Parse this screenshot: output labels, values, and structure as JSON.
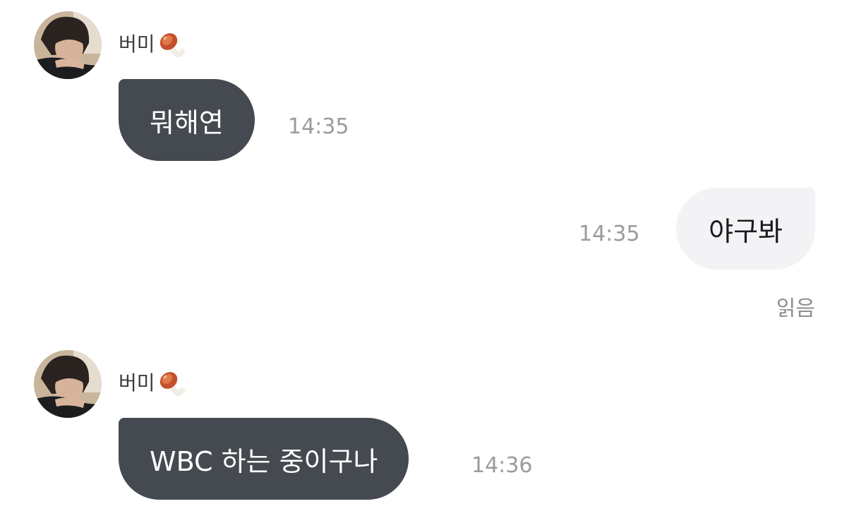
{
  "messages": [
    {
      "sender": "버미",
      "text": "뭐해연",
      "time": "14:35",
      "direction": "incoming"
    },
    {
      "text": "야구봐",
      "time": "14:35",
      "direction": "outgoing"
    },
    {
      "sender": "버미",
      "text": "WBC 하는 중이구나",
      "time": "14:36",
      "direction": "incoming"
    }
  ],
  "read_receipt": "읽음",
  "sender_emoji": "meat-on-bone-icon",
  "colors": {
    "incoming_bubble": "#454950",
    "outgoing_bubble": "#f3f3f6",
    "time_text": "#9b9b9e"
  }
}
